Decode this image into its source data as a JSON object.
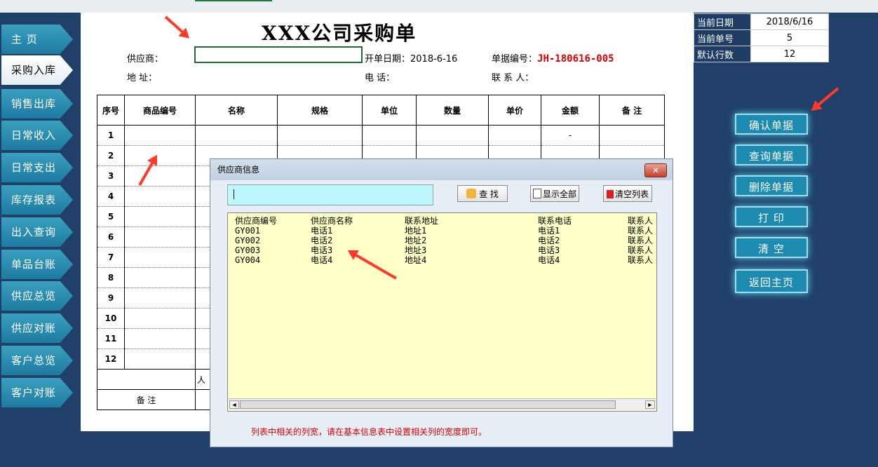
{
  "nav": {
    "items": [
      "主 页",
      "采购入库",
      "销售出库",
      "日常收入",
      "日常支出",
      "库存报表",
      "出入查询",
      "单品台账",
      "供应总览",
      "供应对账",
      "客户总览",
      "客户对账"
    ]
  },
  "form": {
    "title": "XXX公司采购单",
    "supplier_label": "供应商：",
    "address_label": "地 址：",
    "date_label": "开单日期：",
    "date_value": "2018-6-16",
    "phone_label": "电 话：",
    "docno_label": "单据编号：",
    "docno_value": "JH-180616-005",
    "contact_label": "联 系 人：",
    "columns": [
      "序号",
      "商品编号",
      "名称",
      "规格",
      "单位",
      "数量",
      "单价",
      "金额",
      "备 注"
    ],
    "row_numbers": [
      "1",
      "2",
      "3",
      "4",
      "5",
      "6",
      "7",
      "8",
      "9",
      "10",
      "11",
      "12"
    ],
    "amount_placeholder": "-",
    "total_label_fragment": "人",
    "remarks_label": "备 注"
  },
  "info": {
    "rows": [
      {
        "k": "当前日期",
        "v": "2018/6/16"
      },
      {
        "k": "当前单号",
        "v": "5"
      },
      {
        "k": "默认行数",
        "v": "12"
      }
    ]
  },
  "actions": [
    "确认单据",
    "查询单据",
    "删除单据",
    "打 印",
    "清 空",
    "返回主页"
  ],
  "dialog": {
    "title": "供应商信息",
    "close": "✕",
    "search_value": "",
    "find_label": "查 找",
    "showall_label": "显示全部",
    "clear_label": "清空列表",
    "list_header": [
      "供应商编号",
      "供应商名称",
      "联系地址",
      "联系电话",
      "联系人"
    ],
    "list_rows": [
      [
        "GY001",
        "电话1",
        "地址1",
        "电话1",
        "联系人"
      ],
      [
        "GY002",
        "电话2",
        "地址2",
        "电话2",
        "联系人"
      ],
      [
        "GY003",
        "电话3",
        "地址3",
        "电话3",
        "联系人"
      ],
      [
        "GY004",
        "电话4",
        "地址4",
        "电话4",
        "联系人"
      ]
    ],
    "note": "列表中相关的列宽，请在基本信息表中设置相关列的宽度即可。"
  },
  "colors": {
    "accent": "#1d8ab0",
    "background": "#20406a",
    "list_bg": "#ffffc8",
    "note": "#d60000"
  }
}
